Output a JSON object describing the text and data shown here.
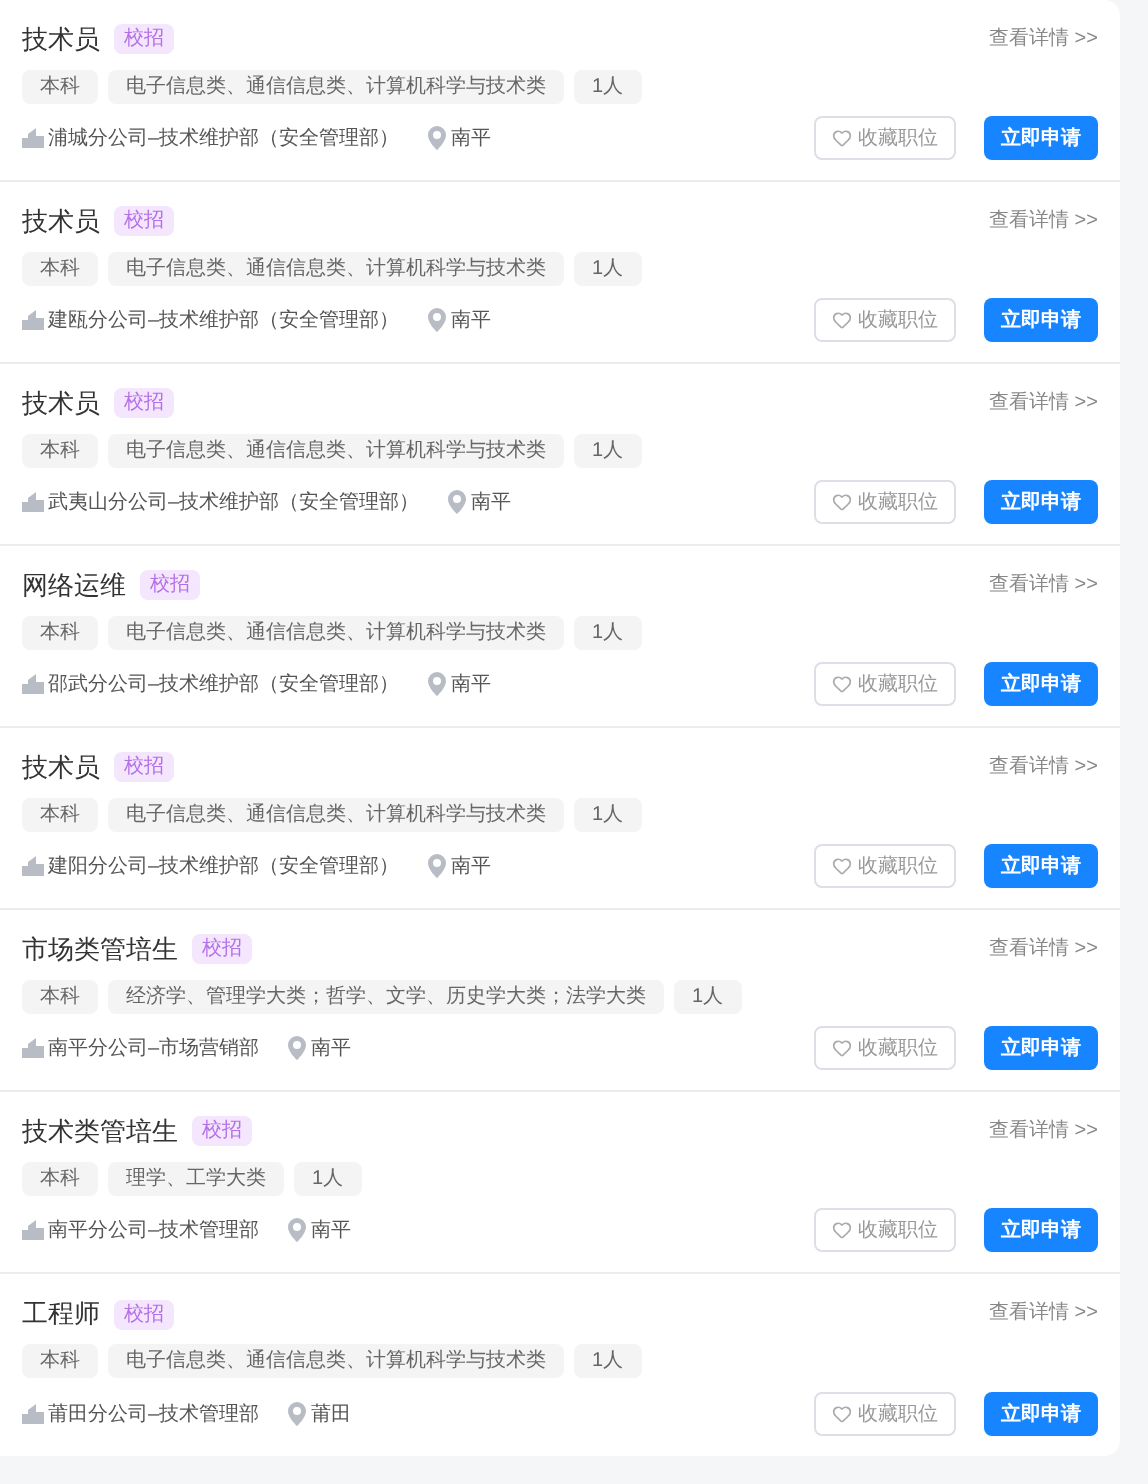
{
  "jobs": [
    {
      "title": "技术员",
      "badge": "校招",
      "tags": [
        "本科",
        "电子信息类、通信信息类、计算机科学与技术类",
        "1人"
      ],
      "department": "浦城分公司–技术维护部（安全管理部）",
      "location": "南平",
      "details_link": "查看详情 >>",
      "favorite_button": "收藏职位",
      "apply_button": "立即申请"
    },
    {
      "title": "技术员",
      "badge": "校招",
      "tags": [
        "本科",
        "电子信息类、通信信息类、计算机科学与技术类",
        "1人"
      ],
      "department": "建瓯分公司–技术维护部（安全管理部）",
      "location": "南平",
      "details_link": "查看详情 >>",
      "favorite_button": "收藏职位",
      "apply_button": "立即申请"
    },
    {
      "title": "技术员",
      "badge": "校招",
      "tags": [
        "本科",
        "电子信息类、通信信息类、计算机科学与技术类",
        "1人"
      ],
      "department": "武夷山分公司–技术维护部（安全管理部）",
      "location": "南平",
      "details_link": "查看详情 >>",
      "favorite_button": "收藏职位",
      "apply_button": "立即申请"
    },
    {
      "title": "网络运维",
      "badge": "校招",
      "tags": [
        "本科",
        "电子信息类、通信信息类、计算机科学与技术类",
        "1人"
      ],
      "department": "邵武分公司–技术维护部（安全管理部）",
      "location": "南平",
      "details_link": "查看详情 >>",
      "favorite_button": "收藏职位",
      "apply_button": "立即申请"
    },
    {
      "title": "技术员",
      "badge": "校招",
      "tags": [
        "本科",
        "电子信息类、通信信息类、计算机科学与技术类",
        "1人"
      ],
      "department": "建阳分公司–技术维护部（安全管理部）",
      "location": "南平",
      "details_link": "查看详情 >>",
      "favorite_button": "收藏职位",
      "apply_button": "立即申请"
    },
    {
      "title": "市场类管培生",
      "badge": "校招",
      "tags": [
        "本科",
        "经济学、管理学大类；哲学、文学、历史学大类；法学大类",
        "1人"
      ],
      "department": "南平分公司–市场营销部",
      "location": "南平",
      "details_link": "查看详情 >>",
      "favorite_button": "收藏职位",
      "apply_button": "立即申请"
    },
    {
      "title": "技术类管培生",
      "badge": "校招",
      "tags": [
        "本科",
        "理学、工学大类",
        "1人"
      ],
      "department": "南平分公司–技术管理部",
      "location": "南平",
      "details_link": "查看详情 >>",
      "favorite_button": "收藏职位",
      "apply_button": "立即申请"
    },
    {
      "title": "工程师",
      "badge": "校招",
      "tags": [
        "本科",
        "电子信息类、通信信息类、计算机科学与技术类",
        "1人"
      ],
      "department": "莆田分公司–技术管理部",
      "location": "莆田",
      "details_link": "查看详情 >>",
      "favorite_button": "收藏职位",
      "apply_button": "立即申请"
    }
  ]
}
